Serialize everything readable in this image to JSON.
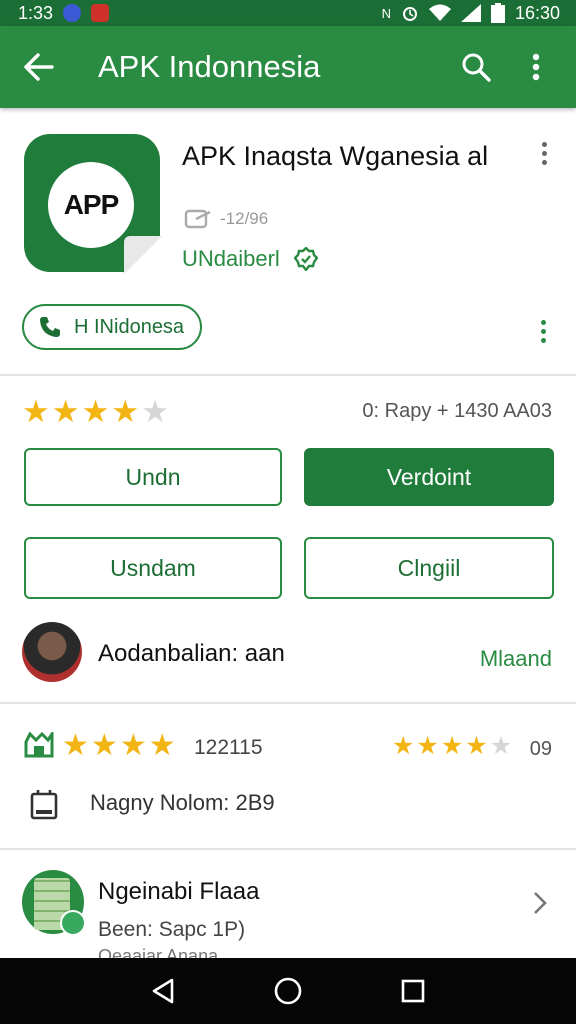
{
  "status_bar": {
    "time_left": "1:33",
    "time_right": "16:30",
    "icons": [
      "messenger-icon",
      "app-notification-icon",
      "nfc-icon",
      "alarm-icon",
      "wifi-icon",
      "signal-icon",
      "battery-icon"
    ]
  },
  "app_bar": {
    "title": "APK Indonnesia",
    "icons": [
      "back-arrow-icon",
      "search-icon",
      "more-vert-icon"
    ]
  },
  "header": {
    "icon_text": "APP",
    "app_name": "APK Inaqsta Wganesia al",
    "developer": "-12/96",
    "verified_label": "UNdaiberl",
    "chip_label": "H INidonesa"
  },
  "rating": {
    "stars": 4,
    "max_stars": 5,
    "count_text": "0: Rapy + 1430 AA03"
  },
  "buttons": {
    "b1": "Undn",
    "b2": "Verdoint",
    "b3": "Usndam",
    "b4": "Clngiil"
  },
  "reviewer": {
    "name": "Aodanbalian: aan",
    "manage": "Mlaand"
  },
  "stats": {
    "left_stars": 4,
    "left_count": "122115",
    "right_stars": 4,
    "right_count": "09",
    "line": "Nagny Nolom: 2B9"
  },
  "list_item": {
    "title": "Ngeinabi Flaaa",
    "subtitle": "Been: Sapc 1P)",
    "subtitle2": "Qeaaiar Anana"
  },
  "colors": {
    "primary": "#2a8b43",
    "status_bar": "#1b6e35",
    "star": "#f2b513"
  }
}
